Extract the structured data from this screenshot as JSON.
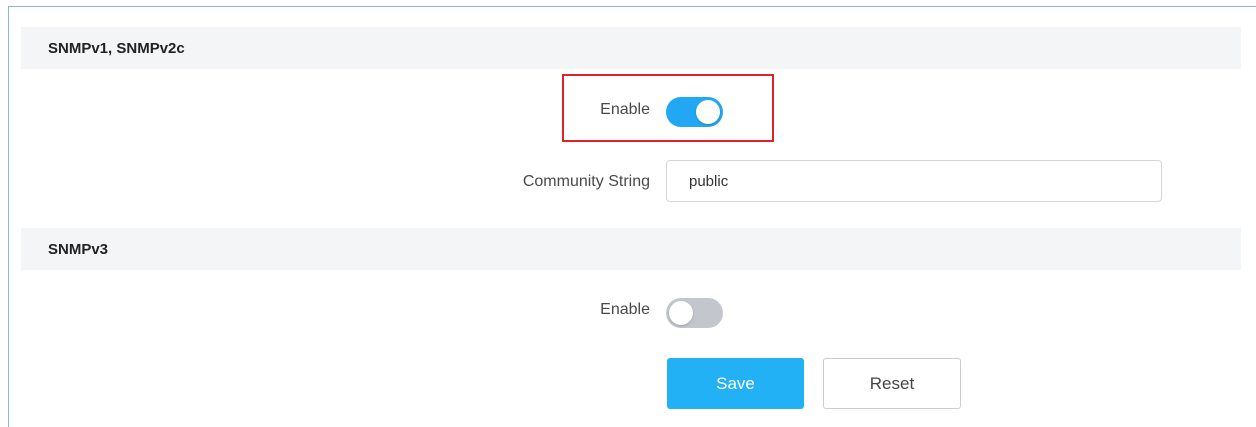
{
  "snmpv1v2c": {
    "title": "SNMPv1, SNMPv2c",
    "enable_label": "Enable",
    "enable_state": true,
    "community_label": "Community String",
    "community_value": "public"
  },
  "snmpv3": {
    "title": "SNMPv3",
    "enable_label": "Enable",
    "enable_state": false
  },
  "actions": {
    "save_label": "Save",
    "reset_label": "Reset"
  },
  "colors": {
    "accent": "#22a8f3",
    "highlight": "#e0212a",
    "toggle_off": "#c3c6cc"
  }
}
